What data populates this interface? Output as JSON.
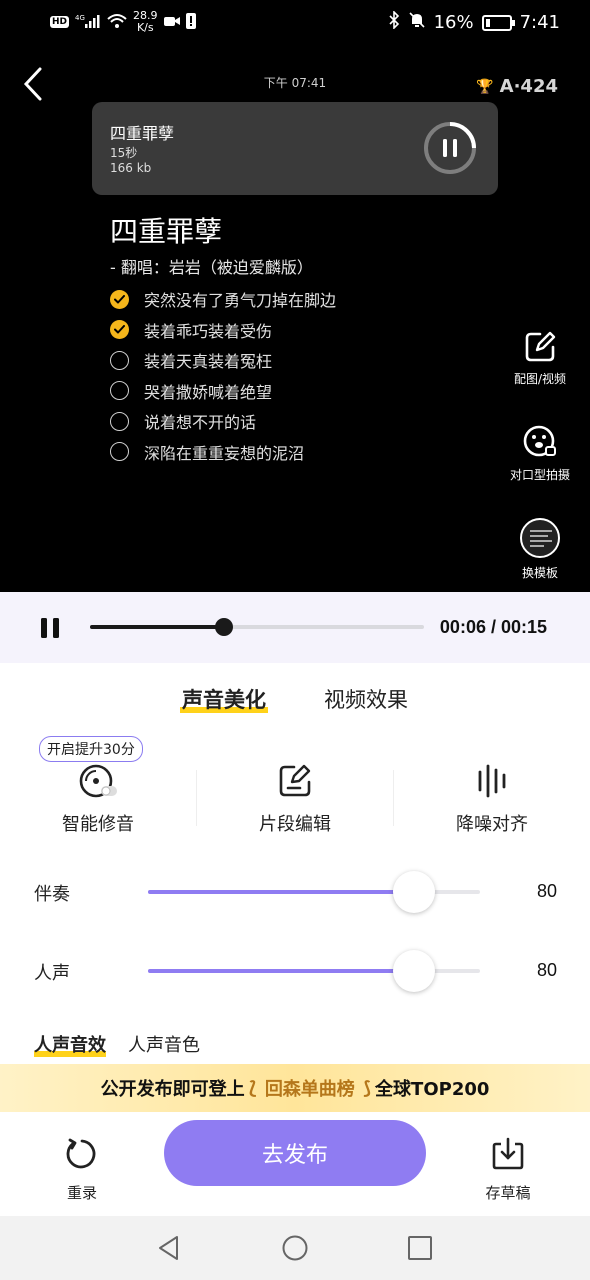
{
  "status": {
    "left_badge": "HD",
    "network": "4G",
    "speed_value": "28.9",
    "speed_unit": "K/s",
    "battery": "16%",
    "time": "7:41"
  },
  "preview": {
    "record_time": "下午 07:41",
    "score": "A·424",
    "card": {
      "title": "四重罪孽",
      "duration": "15秒",
      "size": "166 kb"
    },
    "song_title": "四重罪孽",
    "singer": "-  翻唱：岩岩（被迫爱麟版）",
    "lyrics": [
      {
        "text": "突然没有了勇气刀掉在脚边",
        "checked": true
      },
      {
        "text": "装着乖巧装着受伤",
        "checked": true
      },
      {
        "text": "装着天真装着冤枉",
        "checked": false
      },
      {
        "text": "哭着撒娇喊着绝望",
        "checked": false
      },
      {
        "text": "说着想不开的话",
        "checked": false
      },
      {
        "text": "深陷在重重妄想的泥沼",
        "checked": false
      }
    ],
    "side_tools": {
      "image_video": "配图/视频",
      "lip_sync": "对口型拍摄",
      "template": "换模板"
    }
  },
  "playback": {
    "time": "00:06 / 00:15",
    "progress": 0.4
  },
  "tabs": {
    "voice": "声音美化",
    "video": "视频效果"
  },
  "promo_tag": "开启提升30分",
  "tools": {
    "auto_tune": "智能修音",
    "segment_edit": "片段编辑",
    "denoise_align": "降噪对齐"
  },
  "sliders": {
    "accompaniment": {
      "label": "伴奏",
      "value": "80",
      "level": 0.8
    },
    "vocal": {
      "label": "人声",
      "value": "80",
      "level": 0.8
    }
  },
  "subtabs": {
    "effect": "人声音效",
    "timbre": "人声音色"
  },
  "banner": {
    "prefix": "公开发布即可登上",
    "highlight": "回森单曲榜",
    "suffix": "全球TOP200"
  },
  "bottom": {
    "rerecord": "重录",
    "publish": "去发布",
    "save_draft": "存草稿"
  },
  "colors": {
    "accent": "#8f7cf2",
    "highlight": "#ffd21a",
    "check": "#f5b61b"
  }
}
